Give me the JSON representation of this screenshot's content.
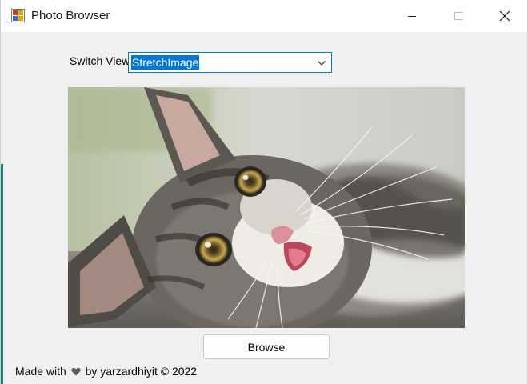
{
  "window": {
    "title": "Photo Browser",
    "controls": {
      "minimize": "minimize",
      "maximize": "maximize",
      "close": "close"
    }
  },
  "switch_view": {
    "label": "Switch View",
    "selected": "StretchImage"
  },
  "picture": {
    "content": "tabby-cat-photo"
  },
  "browse_button": {
    "label": "Browse"
  },
  "footer": {
    "made_with": "Made with",
    "heart": "♥",
    "by": "by yarzardhiyit © 2022"
  },
  "colors": {
    "accent": "#0078d7",
    "window_bg": "#f0f0f0",
    "titlebar_bg": "#ffffff"
  }
}
